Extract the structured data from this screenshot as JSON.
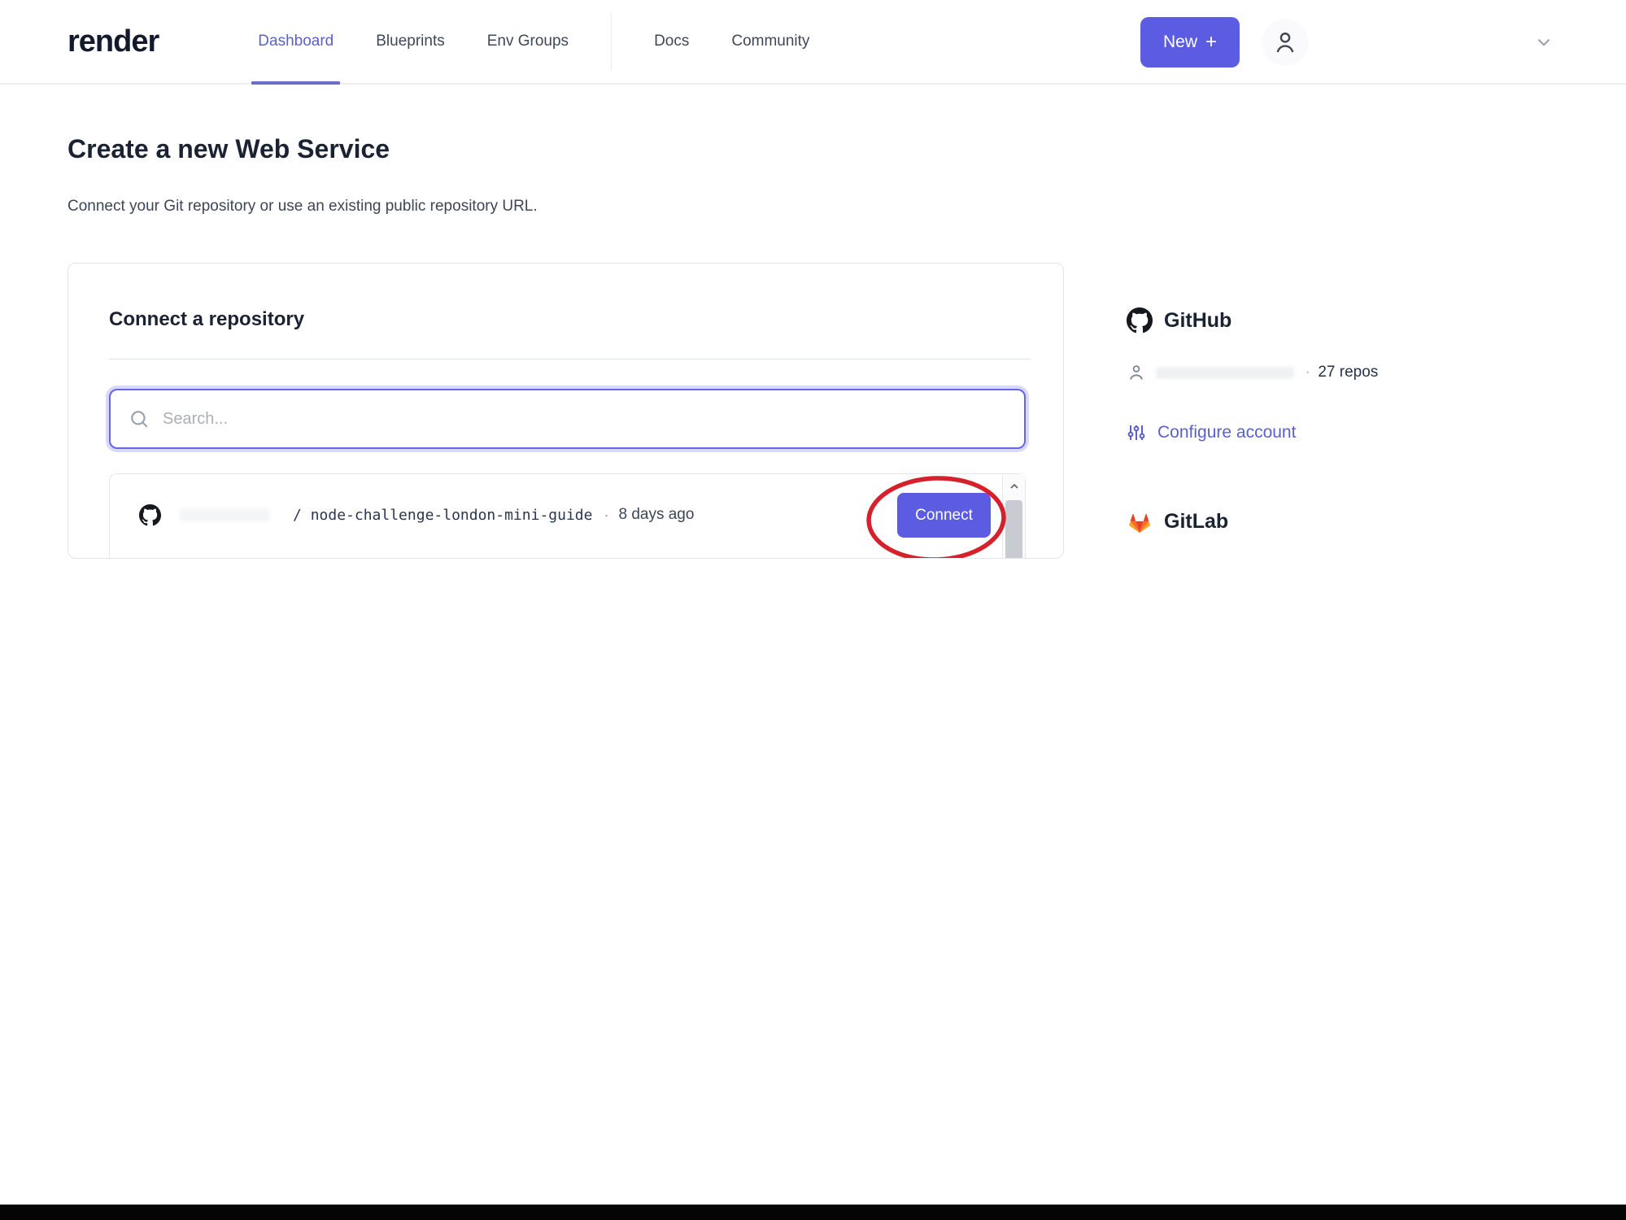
{
  "header": {
    "logo": "render",
    "nav": [
      {
        "label": "Dashboard",
        "active": true
      },
      {
        "label": "Blueprints",
        "active": false
      },
      {
        "label": "Env Groups",
        "active": false
      },
      {
        "label": "Docs",
        "active": false
      },
      {
        "label": "Community",
        "active": false
      }
    ],
    "new_button": {
      "label": "New",
      "plus": "+"
    }
  },
  "page": {
    "title_prefix": "Create a new ",
    "title_emphasis": "Web Service",
    "subtitle": "Connect your Git repository or use an existing public repository URL."
  },
  "card": {
    "heading": "Connect a repository",
    "search": {
      "placeholder": "Search..."
    },
    "repo": {
      "owner_redacted": true,
      "slash": "/ ",
      "name": "node-challenge-london-mini-guide",
      "separator": "·",
      "updated": "8 days ago",
      "connect_label": "Connect"
    }
  },
  "sidebar": {
    "github": {
      "title": "GitHub",
      "account_redacted": true,
      "separator": "·",
      "repos_count": "27 repos",
      "configure_label": "Configure account"
    },
    "gitlab": {
      "title": "GitLab"
    }
  },
  "colors": {
    "accent_purple": "#5b5ce2",
    "link_purple": "#5a5fd1",
    "annotation_red": "#d6202c",
    "gitlab_orange": "#e24329",
    "text_dark": "#1b2332",
    "border_light": "#e3e6ea"
  }
}
